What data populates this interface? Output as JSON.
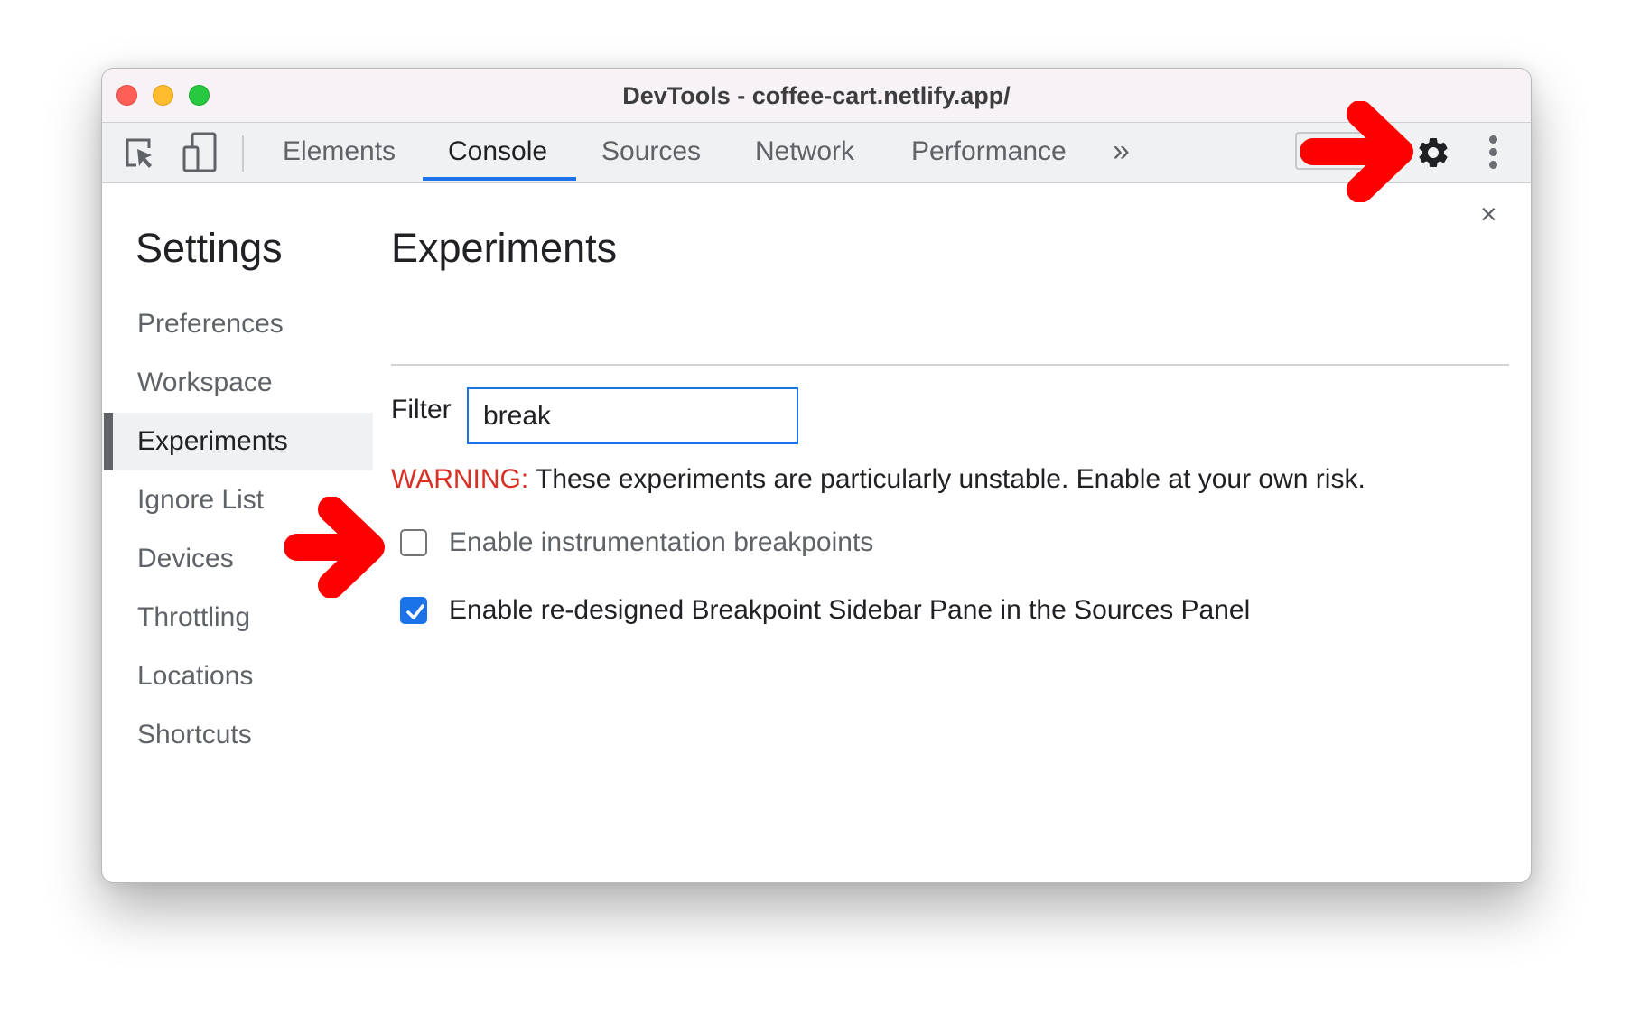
{
  "window": {
    "title": "DevTools - coffee-cart.netlify.app/"
  },
  "toolbar": {
    "inspect_icon": "inspect-element-icon",
    "device_icon": "device-toggle-icon",
    "tabs": [
      {
        "label": "Elements",
        "active": false
      },
      {
        "label": "Console",
        "active": true
      },
      {
        "label": "Sources",
        "active": false
      },
      {
        "label": "Network",
        "active": false
      },
      {
        "label": "Performance",
        "active": false
      }
    ],
    "more_tabs": "»",
    "settings_icon": "gear-icon",
    "menu_icon": "kebab-menu-icon"
  },
  "settings": {
    "title": "Settings",
    "close": "×",
    "nav": [
      {
        "label": "Preferences",
        "selected": false
      },
      {
        "label": "Workspace",
        "selected": false
      },
      {
        "label": "Experiments",
        "selected": true
      },
      {
        "label": "Ignore List",
        "selected": false
      },
      {
        "label": "Devices",
        "selected": false
      },
      {
        "label": "Throttling",
        "selected": false
      },
      {
        "label": "Locations",
        "selected": false
      },
      {
        "label": "Shortcuts",
        "selected": false
      }
    ]
  },
  "experiments": {
    "title": "Experiments",
    "filter_label": "Filter",
    "filter_value": "break",
    "warning_label": "WARNING:",
    "warning_text": " These experiments are particularly unstable. Enable at your own risk.",
    "items": [
      {
        "label": "Enable instrumentation breakpoints",
        "checked": false
      },
      {
        "label": "Enable re-designed Breakpoint Sidebar Pane in the Sources Panel",
        "checked": true
      }
    ]
  },
  "annotations": {
    "arrow_color": "#ff0000"
  },
  "colors": {
    "accent": "#1a73e8",
    "warning": "#d93025"
  }
}
